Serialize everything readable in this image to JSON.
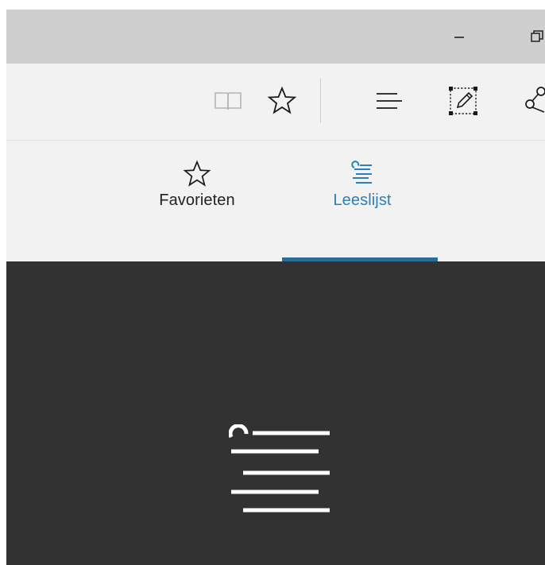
{
  "window": {
    "controls": [
      {
        "name": "minimize",
        "icon": "minimize-icon"
      },
      {
        "name": "restore",
        "icon": "restore-icon"
      }
    ]
  },
  "toolbar": {
    "items": [
      {
        "name": "reading-view",
        "icon": "book-icon"
      },
      {
        "name": "add-favorite",
        "icon": "star-icon"
      },
      {
        "name": "hub",
        "icon": "hub-lines-icon"
      },
      {
        "name": "web-note",
        "icon": "web-note-icon"
      },
      {
        "name": "share",
        "icon": "share-icon"
      }
    ]
  },
  "hub": {
    "tabs": [
      {
        "label": "Favorieten",
        "icon": "star-icon",
        "active": false
      },
      {
        "label": "Leeslijst",
        "icon": "reading-list-icon",
        "active": true
      }
    ],
    "active_color": "#2c7fb8"
  },
  "content": {
    "background": "#323232",
    "icon": "reading-list-icon"
  }
}
